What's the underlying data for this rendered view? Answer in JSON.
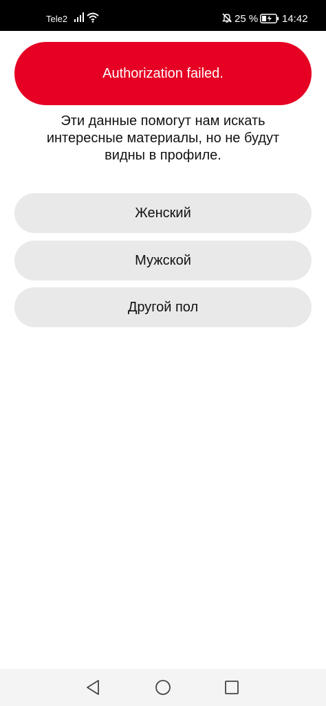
{
  "status_bar": {
    "carrier": "Tele2",
    "battery_percent": "25 %",
    "time": "14:42",
    "icons": [
      "signal-icon",
      "wifi-icon",
      "mute-icon",
      "battery-icon"
    ]
  },
  "error_banner": {
    "text": "Authorization failed.",
    "color": "#e60023"
  },
  "description": "Эти данные помогут нам искать интересные материалы, но не будут видны в профиле.",
  "options": [
    {
      "label": "Женский"
    },
    {
      "label": "Мужской"
    },
    {
      "label": "Другой пол"
    }
  ],
  "nav_bar": {
    "buttons": [
      "back-icon",
      "home-icon",
      "recents-icon"
    ]
  }
}
